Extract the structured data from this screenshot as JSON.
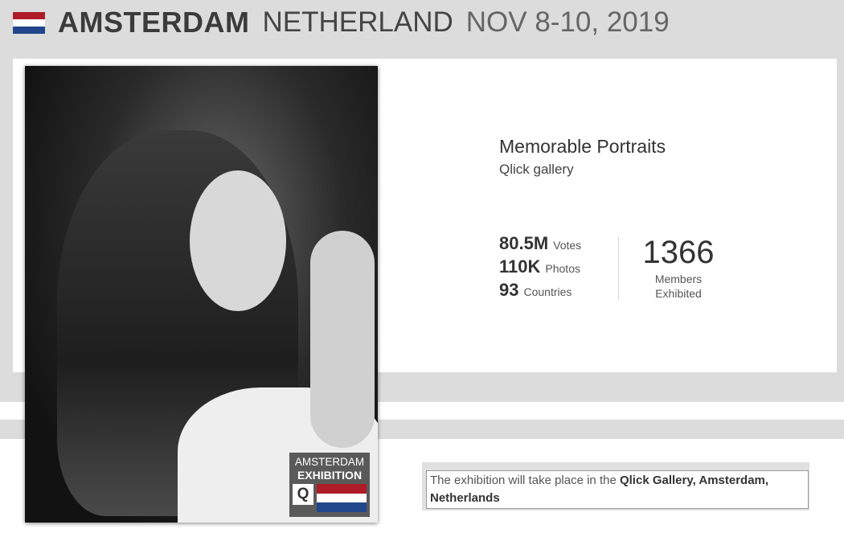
{
  "header": {
    "city": "AMSTERDAM",
    "country": "NETHERLAND",
    "dates": "NOV 8-10, 2019",
    "flag_icon": "netherlands-flag-icon",
    "flag_colors": [
      "#AE1C28",
      "#FFFFFF",
      "#21468B"
    ]
  },
  "exhibit": {
    "title": "Memorable Portraits",
    "subtitle": "Qlick gallery"
  },
  "stats": [
    {
      "value": "80.5M",
      "label": "Votes"
    },
    {
      "value": "110K",
      "label": "Photos"
    },
    {
      "value": "93",
      "label": "Countries"
    }
  ],
  "members": {
    "value": "1366",
    "label_line1": "Members",
    "label_line2": "Exhibited"
  },
  "badge": {
    "line1": "AMSTERDAM",
    "line2": "EXHIBITION",
    "logo_letter": "Q",
    "logo_icon": "qlick-logo-icon",
    "flag_icon": "netherlands-flag-icon"
  },
  "note": {
    "prefix": "The exhibition will take place in the ",
    "place": "Qlick Gallery, Amsterdam, Netherlands"
  },
  "colors": {
    "band": "#dcdcdc",
    "flag_red": "#AE1C28",
    "flag_white": "#FFFFFF",
    "flag_blue": "#21468B"
  }
}
